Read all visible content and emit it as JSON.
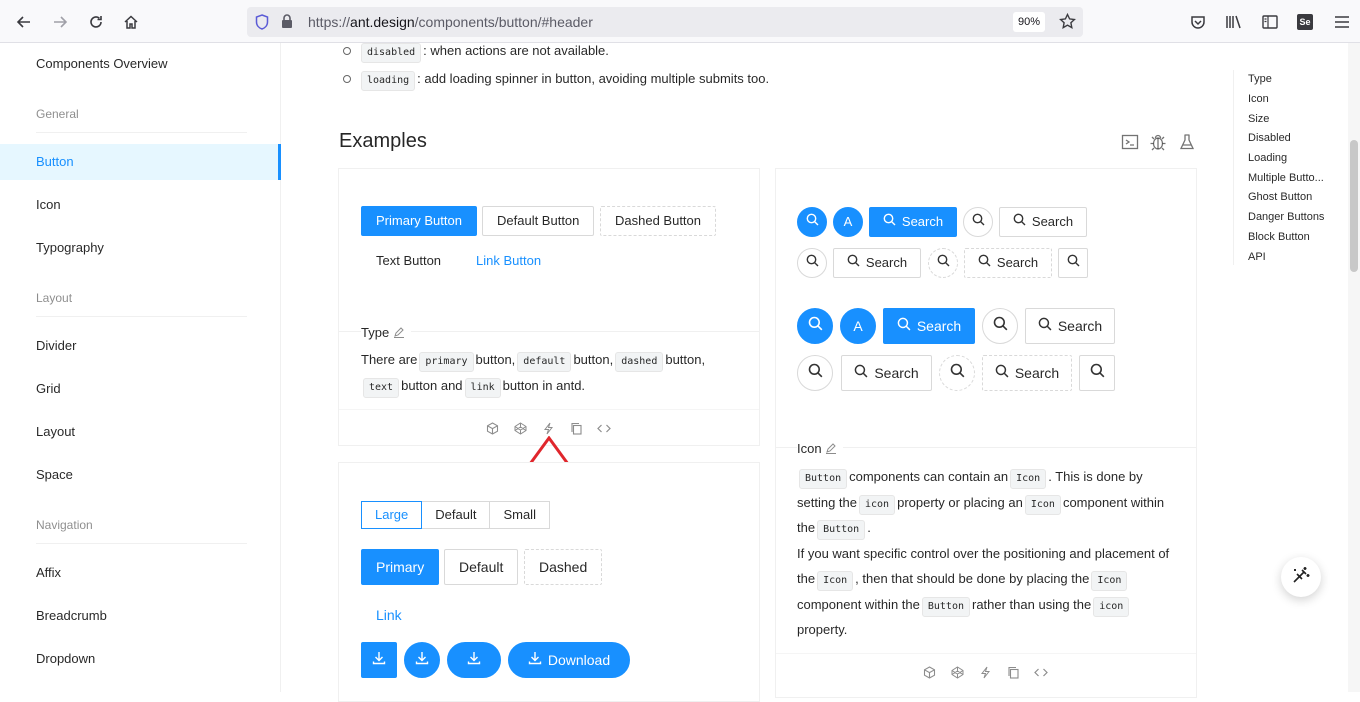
{
  "browser": {
    "url_prefix": "https://",
    "url_host": "ant.design",
    "url_path": "/components/button/#header",
    "zoom": "90%"
  },
  "sidebar": {
    "top_item": "Components Overview",
    "groups": {
      "general": "General",
      "layout": "Layout",
      "navigation": "Navigation"
    },
    "items": {
      "button": "Button",
      "icon": "Icon",
      "typography": "Typography",
      "divider": "Divider",
      "grid": "Grid",
      "layout": "Layout",
      "space": "Space",
      "affix": "Affix",
      "breadcrumb": "Breadcrumb",
      "dropdown": "Dropdown"
    }
  },
  "props": {
    "disabled_code": "disabled",
    "disabled_text": ": when actions are not available.",
    "loading_code": "loading",
    "loading_text": ": add loading spinner in button, avoiding multiple submits too."
  },
  "examples_title": "Examples",
  "type_demo": {
    "primary": "Primary Button",
    "default": "Default Button",
    "dashed": "Dashed Button",
    "text": "Text Button",
    "link": "Link Button",
    "title": "Type",
    "desc": {
      "t1": "There are",
      "c1": "primary",
      "t2": "button,",
      "c2": "default",
      "t3": "button,",
      "c3": "dashed",
      "t4": "button,",
      "c4": "text",
      "t5": "button and",
      "c5": "link",
      "t6": "button in antd."
    }
  },
  "size_demo": {
    "radios": [
      "Large",
      "Default",
      "Small"
    ],
    "primary": "Primary",
    "default": "Default",
    "dashed": "Dashed",
    "link": "Link",
    "download": "Download"
  },
  "icon_demo": {
    "avatar_letter": "A",
    "search": "Search",
    "title": "Icon",
    "desc": {
      "c1": "Button",
      "t1": "components can contain an",
      "c2": "Icon",
      "t2": ". This is done by setting the",
      "c3": "icon",
      "t3": "property or placing an",
      "c4": "Icon",
      "t4": "component within the",
      "c5": "Button",
      "t5": ".",
      "t6": "If you want specific control over the positioning and placement of the",
      "c6": "Icon",
      "t7": ", then that should be done by placing the",
      "c7": "Icon",
      "t8": "component within the",
      "c8": "Button",
      "t9": "rather than using the",
      "c9": "icon",
      "t10": "property."
    }
  },
  "toc": [
    "Type",
    "Icon",
    "Size",
    "Disabled",
    "Loading",
    "Multiple Butto...",
    "Ghost Button",
    "Danger Buttons",
    "Block Button",
    "API"
  ],
  "colors": {
    "primary": "#1890ff",
    "active_bg": "#e6f7ff",
    "arrow": "#e0262c"
  }
}
